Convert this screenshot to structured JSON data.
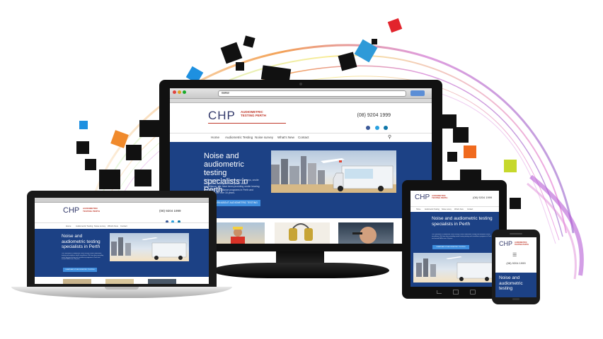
{
  "brand": {
    "logo": "CHP",
    "logo_sub_1": "AUDIOMETRIC",
    "logo_sub_2": "TESTING PERTH",
    "phone": "(08) 9204 1999",
    "accent": "#1c4185",
    "button_color": "#3e8ede",
    "logo_red": "#c0392b"
  },
  "browser": {
    "url": "www"
  },
  "nav": {
    "items": [
      "Home",
      "Audiometric Testing",
      "Noise survey",
      "What's New",
      "Contact"
    ]
  },
  "hero": {
    "title": "Noise and audiometric testing specialists in Perth",
    "body": "CHP specialise in audiometric noise surveys, onsite audiometric testing and workplace health surveillance. We have been providing onsite hearing testing and surveillance programs in Perth and around WA for over 16 years.",
    "button": "LEARN ABOUT AUDIOMETRIC TESTING"
  },
  "tablet": {
    "hero_title": "Noise and audiometric testing specialists in Perth",
    "button": "LEARN ABOUT AUDIOMETRIC TESTING"
  },
  "mobile": {
    "phone": "(08) 9204 1999",
    "hero_title": "Noise and audiometric testing"
  }
}
